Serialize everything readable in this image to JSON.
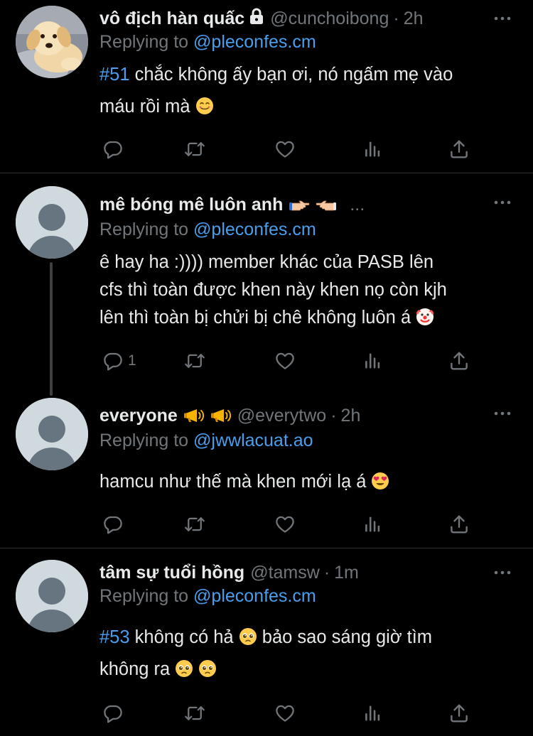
{
  "tweets": [
    {
      "name": "vô địch hàn quấc",
      "handle": "@cunchoibong",
      "dot": "·",
      "time": "2h",
      "replying_prefix": "Replying to ",
      "replying_handle": "@pleconfes.cm",
      "tag": "#51",
      "text_line1": " chắc không ấy bạn ơi, nó ngấm mẹ vào",
      "text_line2": "máu rồi mà ",
      "reply_count": "",
      "avatar": "puppy"
    },
    {
      "name": "mê bóng mê luôn anh",
      "handle": "",
      "ellipsis": "...",
      "replying_prefix": "Replying to ",
      "replying_handle": "@pleconfes.cm",
      "text_line1": "ê hay ha :)))) member khác của PASB lên",
      "text_line2": "cfs thì toàn được khen này khen nọ còn kjh",
      "text_line3": "lên thì toàn bị chửi bị chê không luôn á ",
      "reply_count": "1",
      "avatar": "default"
    },
    {
      "name": "everyone",
      "handle": "@everytwo",
      "dot": "·",
      "time": "2h",
      "replying_prefix": "Replying to ",
      "replying_handle": "@jwwlacuat.ao",
      "text_line1": "hamcu như thế mà khen mới lạ á ",
      "reply_count": "",
      "avatar": "default"
    },
    {
      "name": "tâm sự tuổi hồng",
      "handle": "@tamsw",
      "dot": "·",
      "time": "1m",
      "replying_prefix": "Replying to ",
      "replying_handle": "@pleconfes.cm",
      "tag": "#53",
      "text_line1a": " không có hả ",
      "text_line1b": " bảo sao sáng giờ tìm",
      "text_line2": "không ra ",
      "reply_count": "",
      "avatar": "default"
    }
  ],
  "icons": {
    "reply": "reply-icon",
    "retweet": "retweet-icon",
    "like": "heart-icon",
    "views": "views-icon",
    "share": "share-icon",
    "more": "more-icon",
    "lock": "lock-icon"
  },
  "colors": {
    "background": "#000000",
    "text": "#e7e9ea",
    "muted": "#71767b",
    "link": "#4a9eeb",
    "divider": "#2f3336"
  }
}
